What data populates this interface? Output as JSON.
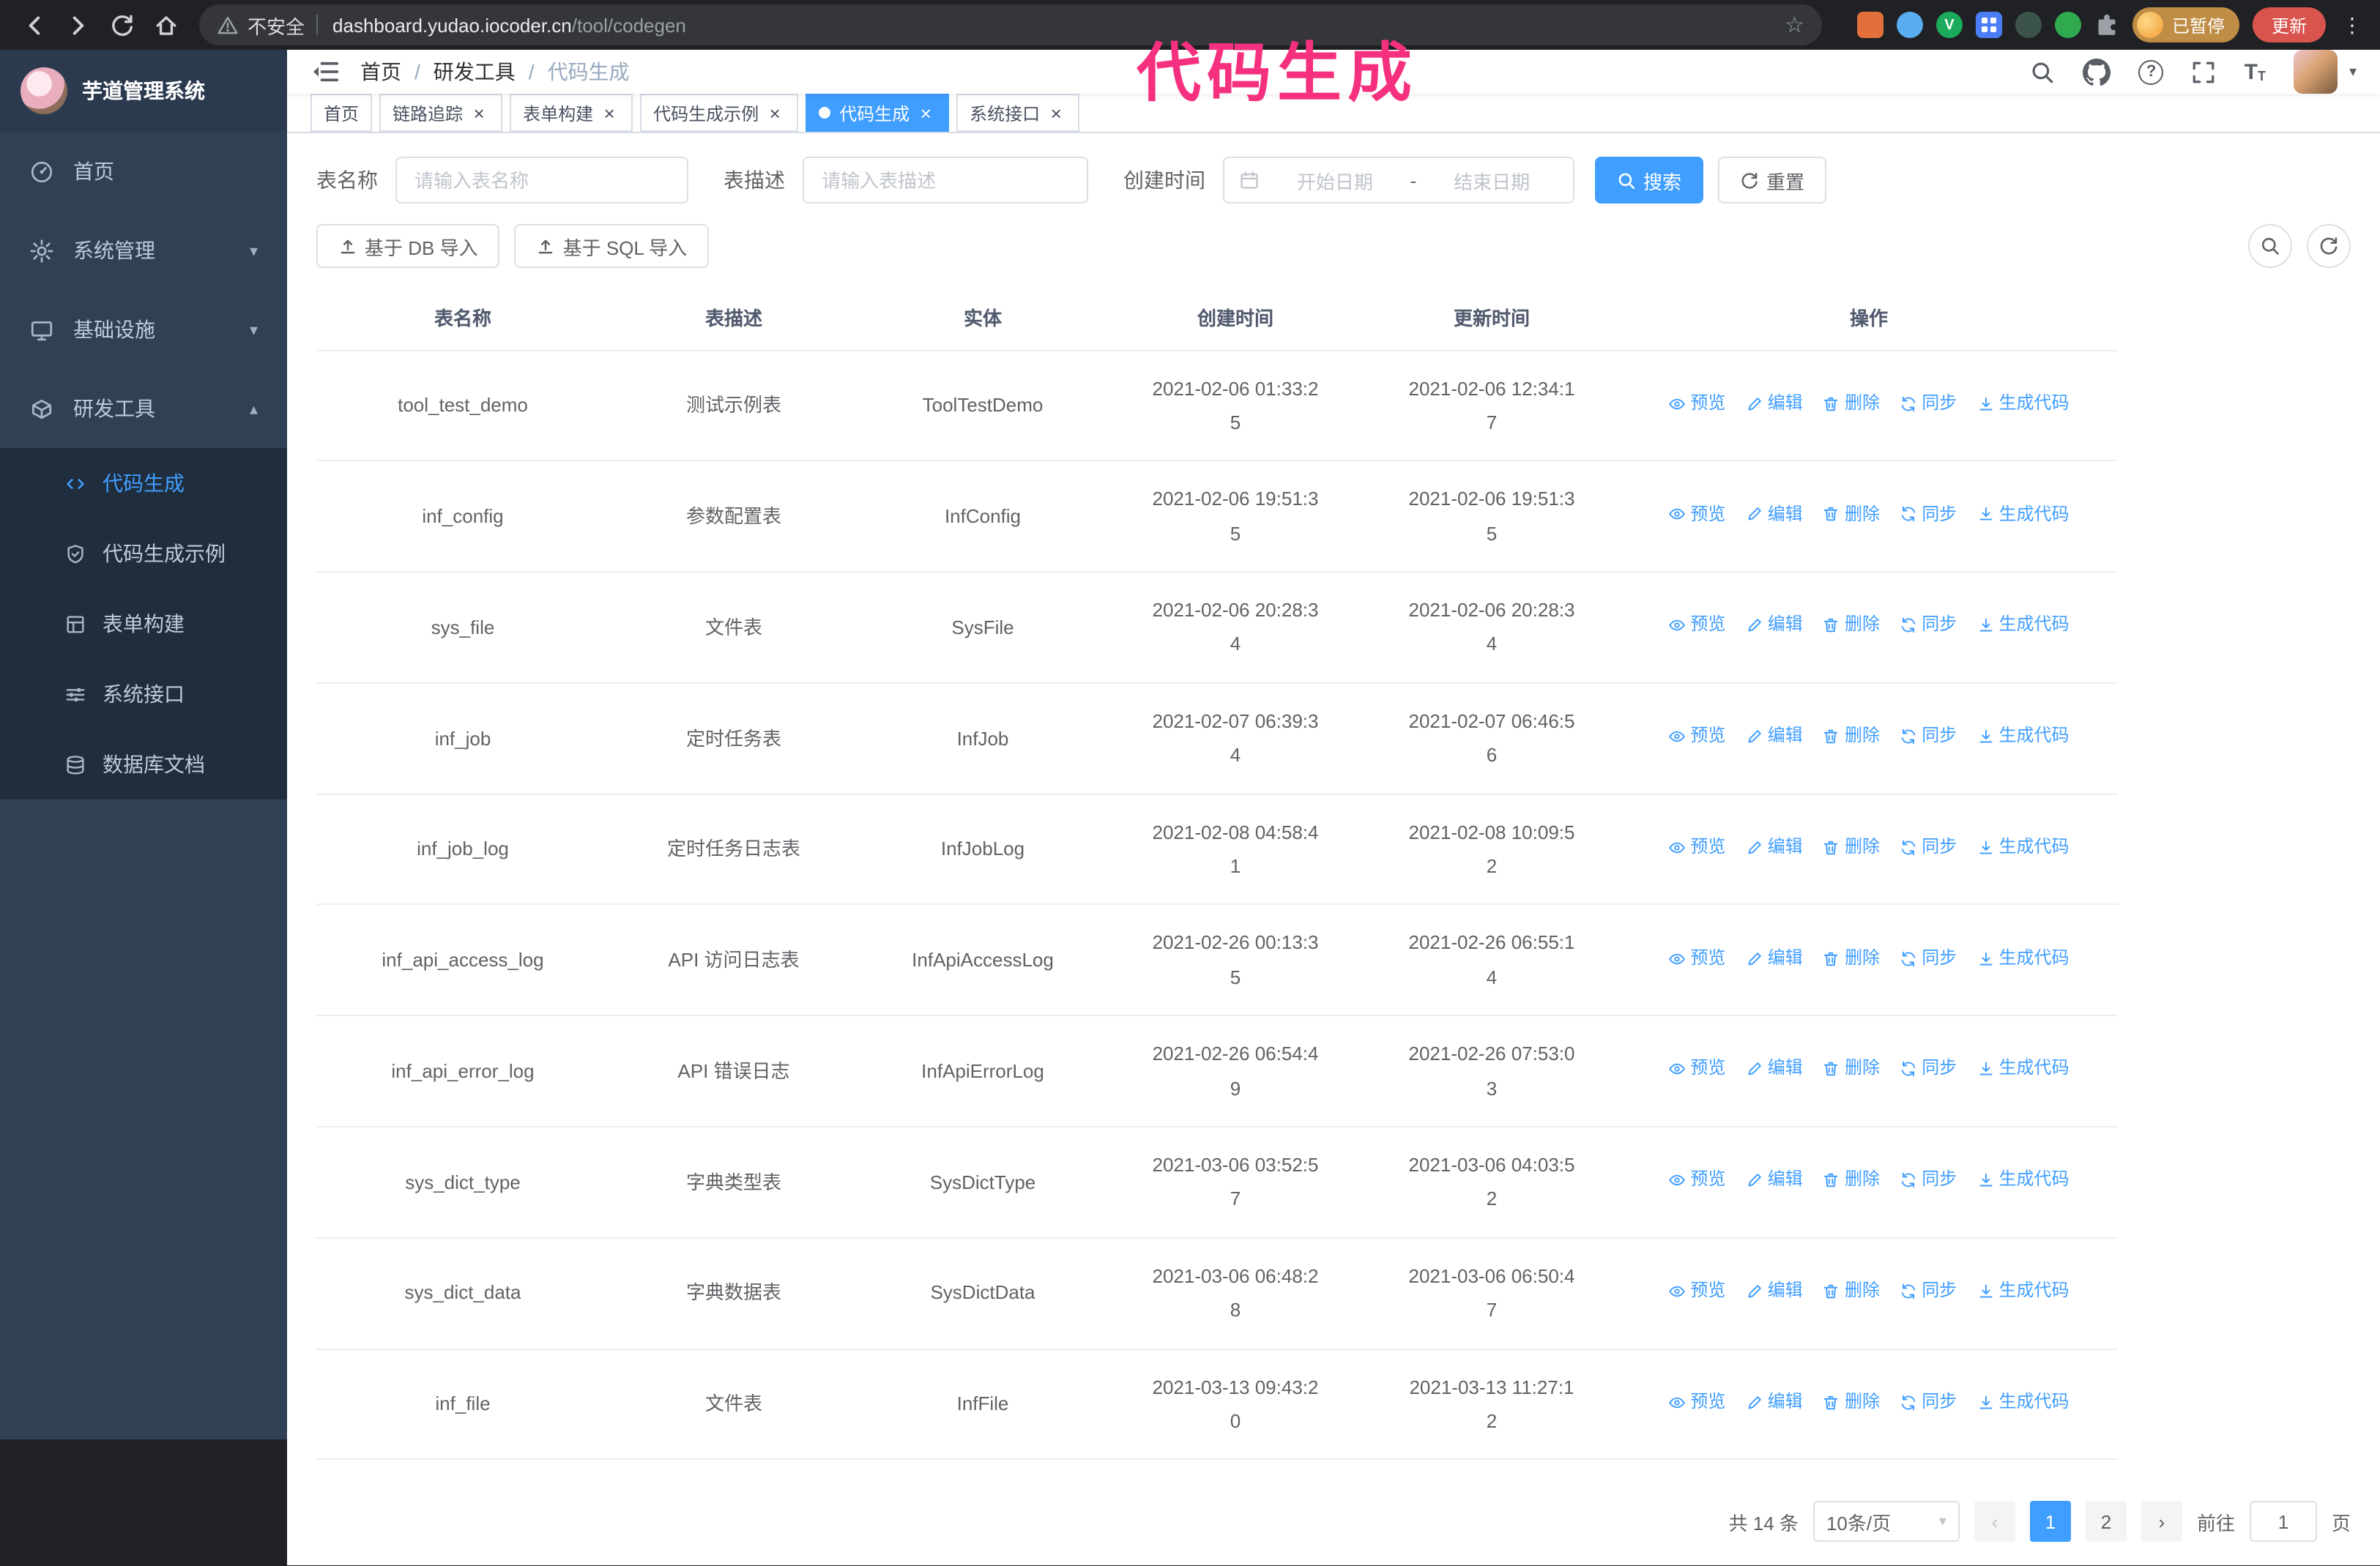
{
  "browser": {
    "security_label": "不安全",
    "url_host": "dashboard.yudao.iocoder.cn",
    "url_path": "/tool/codegen",
    "paused_badge": "已暂停",
    "update_button": "更新"
  },
  "annotation": "代码生成",
  "icons": {
    "close": "×",
    "star": "☆",
    "caret_down": "▾",
    "caret_up": "▴",
    "kebab": "⋮",
    "question": "?",
    "ext_v": "V",
    "prev": "‹",
    "next": "›",
    "font_glyph_large": "T",
    "font_glyph_small": "T"
  },
  "sidebar": {
    "logo_title": "芋道管理系统",
    "items": [
      {
        "label": "首页"
      },
      {
        "label": "系统管理"
      },
      {
        "label": "基础设施"
      },
      {
        "label": "研发工具"
      }
    ],
    "sub_items": [
      {
        "label": "代码生成"
      },
      {
        "label": "代码生成示例"
      },
      {
        "label": "表单构建"
      },
      {
        "label": "系统接口"
      },
      {
        "label": "数据库文档"
      }
    ]
  },
  "header": {
    "separator": "/",
    "breadcrumb": [
      "首页",
      "研发工具",
      "代码生成"
    ]
  },
  "tabs": [
    {
      "label": "首页"
    },
    {
      "label": "链路追踪"
    },
    {
      "label": "表单构建"
    },
    {
      "label": "代码生成示例"
    },
    {
      "label": "代码生成"
    },
    {
      "label": "系统接口"
    }
  ],
  "filters": {
    "table_name_label": "表名称",
    "table_name_placeholder": "请输入表名称",
    "table_desc_label": "表描述",
    "table_desc_placeholder": "请输入表描述",
    "create_time_label": "创建时间",
    "date_start_placeholder": "开始日期",
    "date_separator": "-",
    "date_end_placeholder": "结束日期",
    "search_button": "搜索",
    "reset_button": "重置"
  },
  "toolbar": {
    "import_db_button": "基于 DB 导入",
    "import_sql_button": "基于 SQL 导入"
  },
  "table": {
    "columns": [
      "表名称",
      "表描述",
      "实体",
      "创建时间",
      "更新时间",
      "操作"
    ],
    "actions": [
      "预览",
      "编辑",
      "删除",
      "同步",
      "生成代码"
    ],
    "rows": [
      {
        "name": "tool_test_demo",
        "desc": "测试示例表",
        "entity": "ToolTestDemo",
        "created": "2021-02-06 01:33:25",
        "updated": "2021-02-06 12:34:17"
      },
      {
        "name": "inf_config",
        "desc": "参数配置表",
        "entity": "InfConfig",
        "created": "2021-02-06 19:51:35",
        "updated": "2021-02-06 19:51:35"
      },
      {
        "name": "sys_file",
        "desc": "文件表",
        "entity": "SysFile",
        "created": "2021-02-06 20:28:34",
        "updated": "2021-02-06 20:28:34"
      },
      {
        "name": "inf_job",
        "desc": "定时任务表",
        "entity": "InfJob",
        "created": "2021-02-07 06:39:34",
        "updated": "2021-02-07 06:46:56"
      },
      {
        "name": "inf_job_log",
        "desc": "定时任务日志表",
        "entity": "InfJobLog",
        "created": "2021-02-08 04:58:41",
        "updated": "2021-02-08 10:09:52"
      },
      {
        "name": "inf_api_access_log",
        "desc": "API 访问日志表",
        "entity": "InfApiAccessLog",
        "created": "2021-02-26 00:13:35",
        "updated": "2021-02-26 06:55:14"
      },
      {
        "name": "inf_api_error_log",
        "desc": "API 错误日志",
        "entity": "InfApiErrorLog",
        "created": "2021-02-26 06:54:49",
        "updated": "2021-02-26 07:53:03"
      },
      {
        "name": "sys_dict_type",
        "desc": "字典类型表",
        "entity": "SysDictType",
        "created": "2021-03-06 03:52:57",
        "updated": "2021-03-06 04:03:52"
      },
      {
        "name": "sys_dict_data",
        "desc": "字典数据表",
        "entity": "SysDictData",
        "created": "2021-03-06 06:48:28",
        "updated": "2021-03-06 06:50:47"
      },
      {
        "name": "inf_file",
        "desc": "文件表",
        "entity": "InfFile",
        "created": "2021-03-13 09:43:20",
        "updated": "2021-03-13 11:27:12"
      }
    ]
  },
  "pagination": {
    "total": "共 14 条",
    "page_size": "10条/页",
    "pages": [
      "1",
      "2"
    ],
    "goto_prefix": "前往",
    "goto_value": "1",
    "goto_suffix": "页"
  }
}
